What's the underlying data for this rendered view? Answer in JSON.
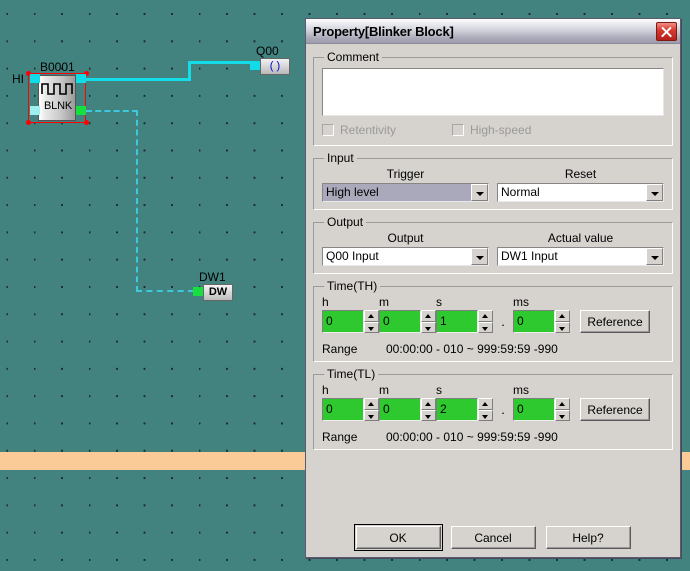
{
  "canvas": {
    "background_color": "#42827f",
    "bar_color": "#fbcb97",
    "blocks": {
      "blinker": {
        "label": "B0001",
        "name": "BLNK",
        "input_label": "HI",
        "selected": true,
        "selection_color": "#ff0000"
      },
      "coil": {
        "label": "Q00",
        "symbol": "( )"
      },
      "datablock": {
        "label": "DW1",
        "name": "DW"
      }
    },
    "wire_color": "#14dde8"
  },
  "dialog": {
    "title": "Property[Blinker Block]",
    "close_label": "✕",
    "comment": {
      "legend": "Comment",
      "value": "",
      "retentivity_label": "Retentivity",
      "highspeed_label": "High-speed",
      "retentivity_checked": false,
      "highspeed_checked": false
    },
    "input": {
      "legend": "Input",
      "trigger_label": "Trigger",
      "trigger_value": "High level",
      "reset_label": "Reset",
      "reset_value": "Normal"
    },
    "output": {
      "legend": "Output",
      "output_label": "Output",
      "output_value": "Q00  Input",
      "actual_label": "Actual value",
      "actual_value": "DW1  Input"
    },
    "time_th": {
      "legend": "Time(TH)",
      "h_label": "h",
      "m_label": "m",
      "s_label": "s",
      "ms_label": "ms",
      "h_value": "0",
      "m_value": "0",
      "s_value": "1",
      "ms_value": "0",
      "separator": ".",
      "reference_label": "Reference",
      "range_label": "Range",
      "range_value": "00:00:00 - 010 ~ 999:59:59 -990"
    },
    "time_tl": {
      "legend": "Time(TL)",
      "h_label": "h",
      "m_label": "m",
      "s_label": "s",
      "ms_label": "ms",
      "h_value": "0",
      "m_value": "0",
      "s_value": "2",
      "ms_value": "0",
      "separator": ".",
      "reference_label": "Reference",
      "range_label": "Range",
      "range_value": "00:00:00 - 010 ~ 999:59:59 -990"
    },
    "footer": {
      "ok_label": "OK",
      "cancel_label": "Cancel",
      "help_label": "Help?"
    }
  }
}
